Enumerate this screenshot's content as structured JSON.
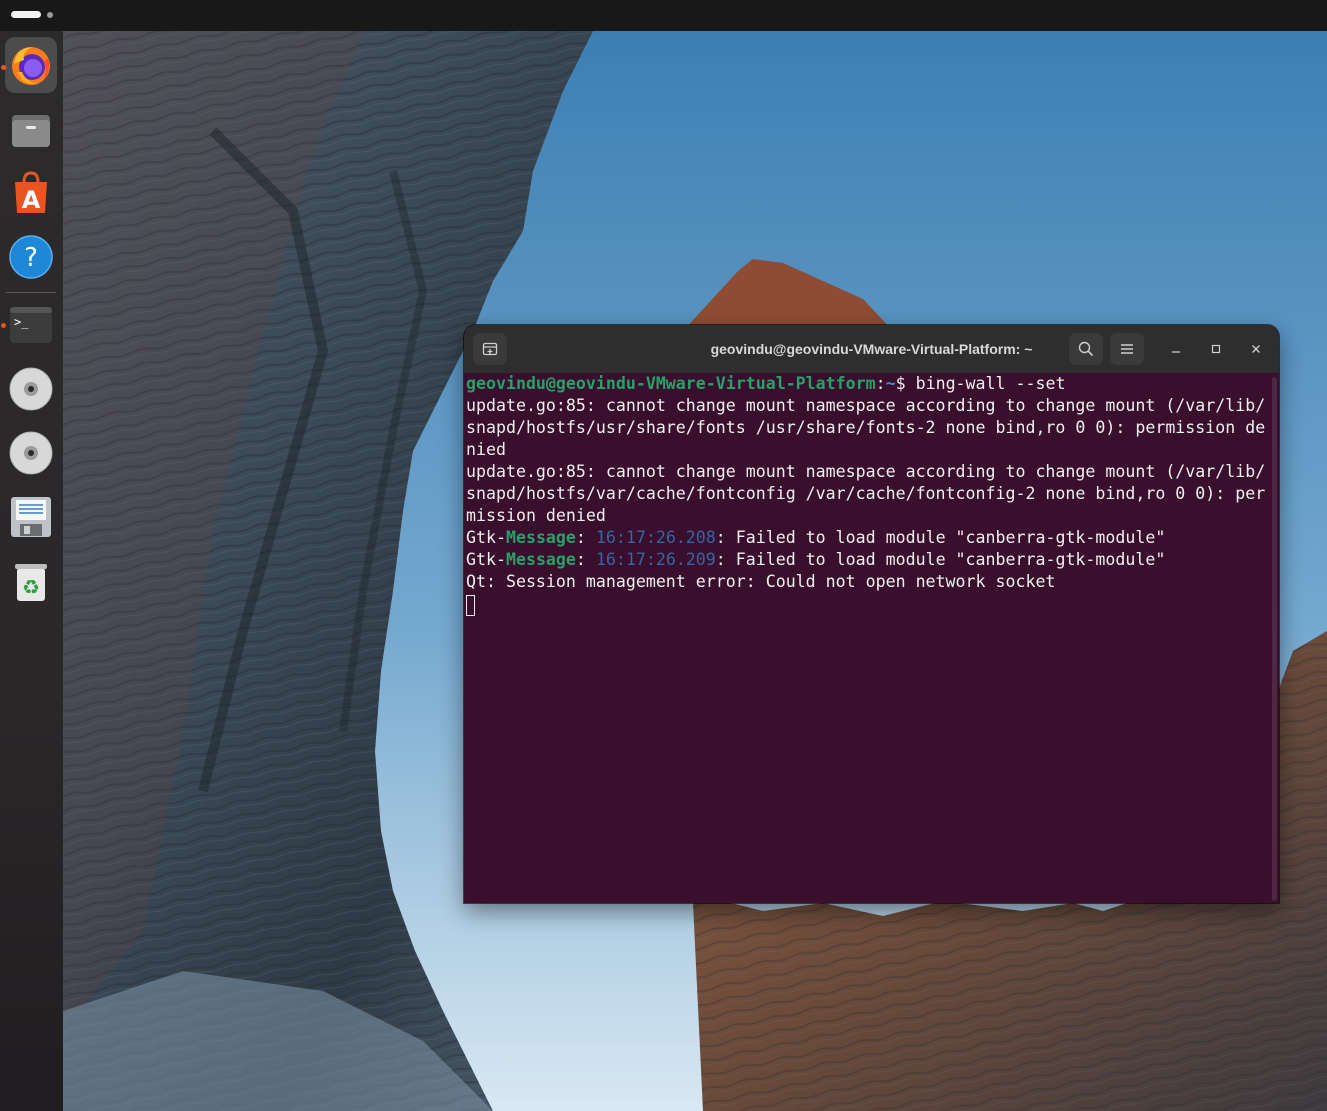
{
  "colors": {
    "terminal_bg": "#3a0f2d",
    "prompt_user": "#26a269",
    "prompt_path": "#3a8dd9",
    "timestamp": "#3465a4",
    "running_indicator": "#e95420"
  },
  "dock": {
    "items": [
      {
        "name": "firefox",
        "icon": "firefox-icon",
        "active": true,
        "running": true
      },
      {
        "name": "files",
        "icon": "files-icon",
        "running": false
      },
      {
        "name": "app-center",
        "icon": "app-center-icon",
        "running": false
      },
      {
        "name": "help",
        "icon": "help-icon",
        "running": false
      },
      {
        "name": "terminal",
        "icon": "terminal-icon",
        "running": true
      },
      {
        "name": "disc-1",
        "icon": "disc-icon",
        "running": false
      },
      {
        "name": "disc-2",
        "icon": "disc-icon",
        "running": false
      },
      {
        "name": "floppy",
        "icon": "floppy-disk-icon",
        "running": false
      },
      {
        "name": "trash",
        "icon": "trash-icon",
        "running": false
      }
    ],
    "terminal_glyph": ">_",
    "help_glyph": "?",
    "appcenter_glyph": "A",
    "trash_glyph": "♻"
  },
  "terminal": {
    "title": "geovindu@geovindu-VMware-Virtual-Platform: ~",
    "prompt": {
      "user_host": "geovindu@geovindu-VMware-Virtual-Platform",
      "sep": ":",
      "path": "~",
      "dollar": "$ ",
      "command": "bing-wall --set"
    },
    "output": [
      "update.go:85: cannot change mount namespace according to change mount (/var/lib/",
      "snapd/hostfs/usr/share/fonts /usr/share/fonts-2 none bind,ro 0 0): permission de",
      "nied",
      "update.go:85: cannot change mount namespace according to change mount (/var/lib/",
      "snapd/hostfs/var/cache/fontconfig /var/cache/fontconfig-2 none bind,ro 0 0): per",
      "mission denied"
    ],
    "gtk_lines": [
      {
        "prefix": "Gtk-",
        "kind": "Message",
        "colon": ": ",
        "time": "16:17:26.208",
        "text": ": Failed to load module \"canberra-gtk-module\""
      },
      {
        "prefix": "Gtk-",
        "kind": "Message",
        "colon": ": ",
        "time": "16:17:26.209",
        "text": ": Failed to load module \"canberra-gtk-module\""
      }
    ],
    "qt_line": "Qt: Session management error: Could not open network socket"
  }
}
